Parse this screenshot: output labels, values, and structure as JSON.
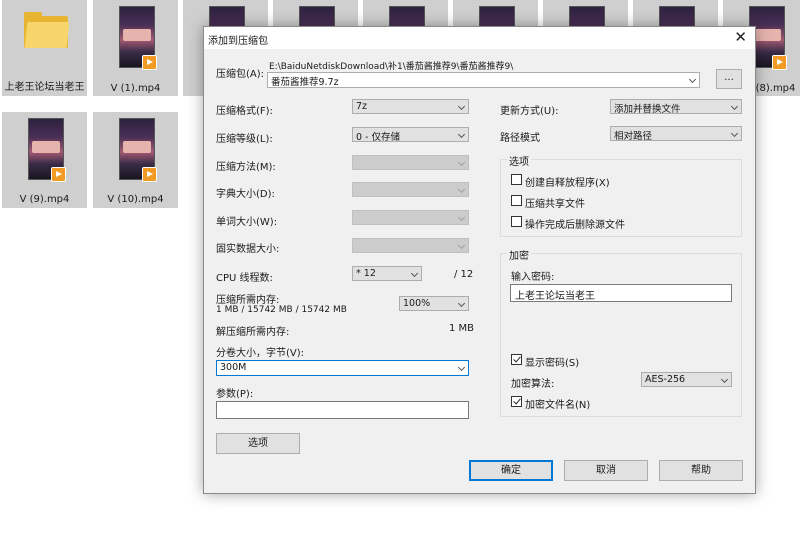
{
  "desktop": {
    "folder_label": "上老王论坛当老王",
    "tiles": [
      "V (1).mp4",
      "V (8).mp4",
      "V (9).mp4",
      "V (10).mp4"
    ]
  },
  "dialog": {
    "title": "添加到压缩包",
    "archive_label": "压缩包(A):",
    "archive_path": "E:\\BaiduNetdiskDownload\\补1\\番茄酱推荐9\\番茄酱推荐9\\",
    "archive_name": "番茄酱推荐9.7z",
    "browse_label": "...",
    "format_label": "压缩格式(F):",
    "format_value": "7z",
    "level_label": "压缩等级(L):",
    "level_value": "0 - 仅存储",
    "method_label": "压缩方法(M):",
    "dict_label": "字典大小(D):",
    "word_label": "单词大小(W):",
    "solid_label": "固实数据大小:",
    "cpu_label": "CPU 线程数:",
    "cpu_value": "* 12",
    "cpu_total": "/ 12",
    "mem_label": "压缩所需内存:",
    "mem_detail": "1 MB / 15742 MB / 15742 MB",
    "mem_percent": "100%",
    "dmem_label": "解压缩所需内存:",
    "dmem_value": "1 MB",
    "split_label": "分卷大小，字节(V):",
    "split_value": "300M",
    "params_label": "参数(P):",
    "params_value": "",
    "options_btn": "选项",
    "update_label": "更新方式(U):",
    "update_value": "添加并替换文件",
    "pathmode_label": "路径模式",
    "pathmode_value": "相对路径",
    "options_group": "选项",
    "opt_sfx": "创建自释放程序(X)",
    "opt_shared": "压缩共享文件",
    "opt_delete": "操作完成后删除源文件",
    "enc_group": "加密",
    "pwd_label": "输入密码:",
    "pwd_value": "上老王论坛当老王",
    "show_pwd": "显示密码(S)",
    "enc_method_label": "加密算法:",
    "enc_method_value": "AES-256",
    "enc_names": "加密文件名(N)",
    "ok": "确定",
    "cancel": "取消",
    "help": "帮助"
  }
}
